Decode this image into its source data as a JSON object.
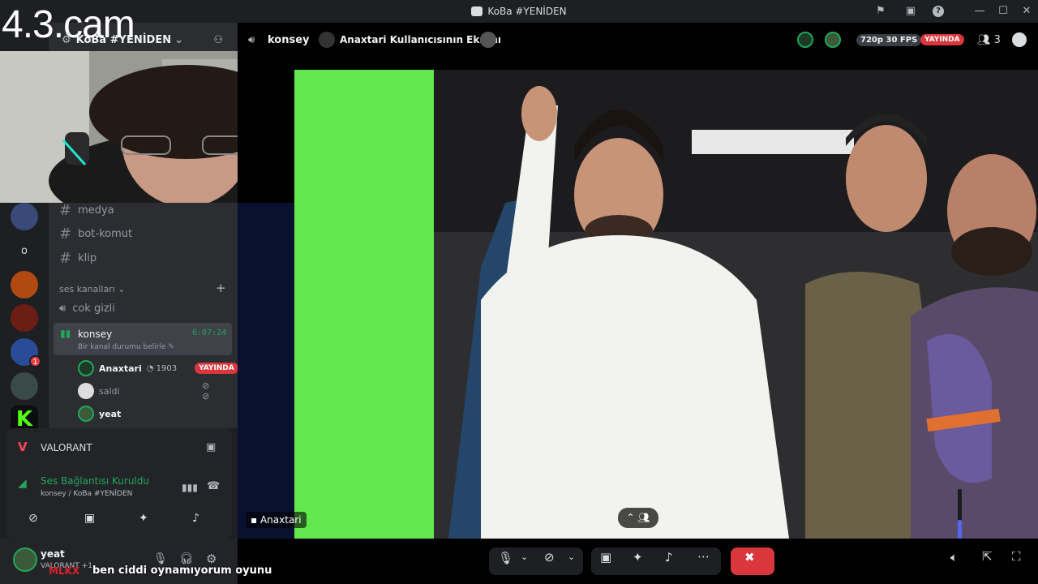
{
  "window": {
    "title": "KoBa #YENİDEN"
  },
  "cam_overlay": {
    "label": "4.3.cam"
  },
  "server": {
    "name": "KoBa #YENİDEN",
    "badge_count": "1",
    "letter": "o"
  },
  "text_channels": [
    {
      "name": "medya"
    },
    {
      "name": "bot-komut"
    },
    {
      "name": "klip"
    }
  ],
  "voice_category": "ses kanalları",
  "voice_channels": [
    {
      "name": "cok gizli"
    },
    {
      "name": "konsey",
      "timer": "6:07:24",
      "status": "Bir kanal durumu belirle"
    }
  ],
  "members": [
    {
      "name": "Anaxtari",
      "extra": "1903",
      "badge": "YAYINDA"
    },
    {
      "name": "saldi"
    },
    {
      "name": "yeat"
    }
  ],
  "activity": {
    "game": "VALORANT"
  },
  "voice_connection": {
    "status": "Ses Bağlantısı Kuruldu",
    "channel": "konsey / KoBa #YENİDEN"
  },
  "user": {
    "name": "yeat",
    "status": "VALORANT +1"
  },
  "stream_header": {
    "channel": "konsey",
    "title": "Anaxtari Kullanıcısının Ekranı",
    "quality": "720p 30 FPS",
    "live": "YAYINDA",
    "viewers": "3"
  },
  "stream": {
    "streamer_label": "Anaxtari"
  },
  "subtitle": {
    "prefix": "MLKX",
    "text": "ben ciddi oynamıyorum oyunu"
  },
  "colors": {
    "accent": "#5865f2",
    "live": "#da373c",
    "online": "#23a55a",
    "disconnect": "#da373c"
  }
}
